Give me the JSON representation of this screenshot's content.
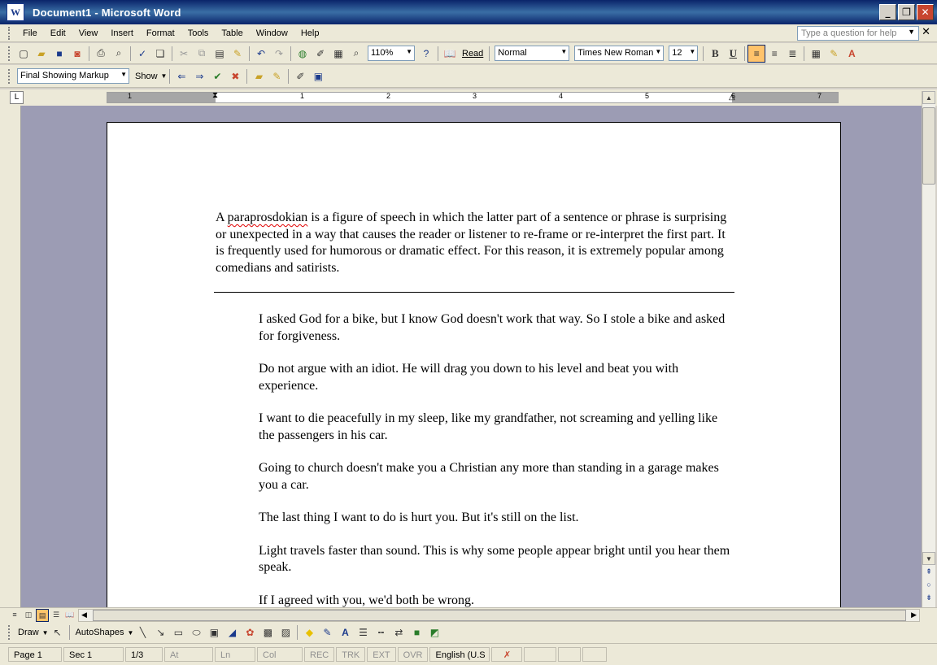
{
  "window": {
    "title": "Document1 - Microsoft Word",
    "app_icon": "W"
  },
  "menu": {
    "items": [
      "File",
      "Edit",
      "View",
      "Insert",
      "Format",
      "Tools",
      "Table",
      "Window",
      "Help"
    ],
    "help_placeholder": "Type a question for help"
  },
  "standard_toolbar": {
    "zoom": "110%",
    "read_label": "Read"
  },
  "formatting_toolbar": {
    "style": "Normal",
    "font": "Times New Roman",
    "size": "12",
    "bold": "B",
    "underline": "U"
  },
  "reviewing_toolbar": {
    "display": "Final Showing Markup",
    "show_label": "Show"
  },
  "ruler": {
    "numbers": [
      "1",
      "1",
      "2",
      "3",
      "4",
      "5",
      "6",
      "7"
    ]
  },
  "document": {
    "intro_word": "paraprosdokian",
    "intro_before": "A ",
    "intro_after": " is a figure of speech in which the latter part of a sentence or phrase is surprising or unexpected in a way that causes the reader or listener to re-frame or re-interpret the first part. It is frequently used for humorous or dramatic effect. For this reason, it is extremely popular among comedians and satirists.",
    "quotes": [
      "I asked God for a bike, but I know God doesn't work that way. So I stole a bike and asked for forgiveness.",
      "Do not argue with an idiot. He will drag you down to his level and beat you with experience.",
      "I want to die peacefully in my sleep, like my grandfather, not screaming and yelling like the passengers in his car.",
      "Going to church doesn't make you a Christian any more than standing in a garage makes you a car.",
      "The last thing I want to do is hurt you. But it's still on the list.",
      "Light travels faster than sound. This is why some people appear bright until you hear them speak.",
      "If I agreed with you, we'd both be wrong."
    ]
  },
  "drawing_toolbar": {
    "draw_label": "Draw",
    "autoshapes_label": "AutoShapes"
  },
  "status": {
    "page": "Page  1",
    "sec": "Sec  1",
    "pages": "1/3",
    "at": "At",
    "ln": "Ln",
    "col": "Col",
    "rec": "REC",
    "trk": "TRK",
    "ext": "EXT",
    "ovr": "OVR",
    "lang": "English (U.S"
  },
  "colors": {
    "title_bar": "#0a246a",
    "workspace": "#9c9cb4",
    "chrome": "#ece9d8",
    "pressed": "#ffc36b"
  }
}
